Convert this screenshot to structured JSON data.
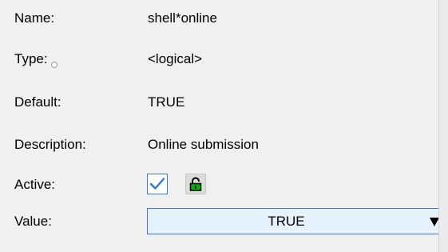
{
  "fields": {
    "name": {
      "label": "Name:",
      "value": "shell*online"
    },
    "type": {
      "label": "Type:",
      "value": "<logical>"
    },
    "default": {
      "label": "Default:",
      "value": "TRUE"
    },
    "description": {
      "label": "Description:",
      "value": "Online submission"
    },
    "active": {
      "label": "Active:",
      "checked": true
    },
    "value": {
      "label": "Value:",
      "selected": "TRUE"
    }
  },
  "icons": {
    "type_indicator": "radio-circle-icon",
    "active_check": "checkmark-icon",
    "lock": "unlocked-padlock-icon",
    "dropdown": "triangle-down-icon"
  },
  "colors": {
    "background": "#f0f0f0",
    "focus_border": "#3c7ad6",
    "check_mark": "#2b7bd8",
    "lock_green": "#00b400",
    "select_background": "#e5f1fb"
  }
}
